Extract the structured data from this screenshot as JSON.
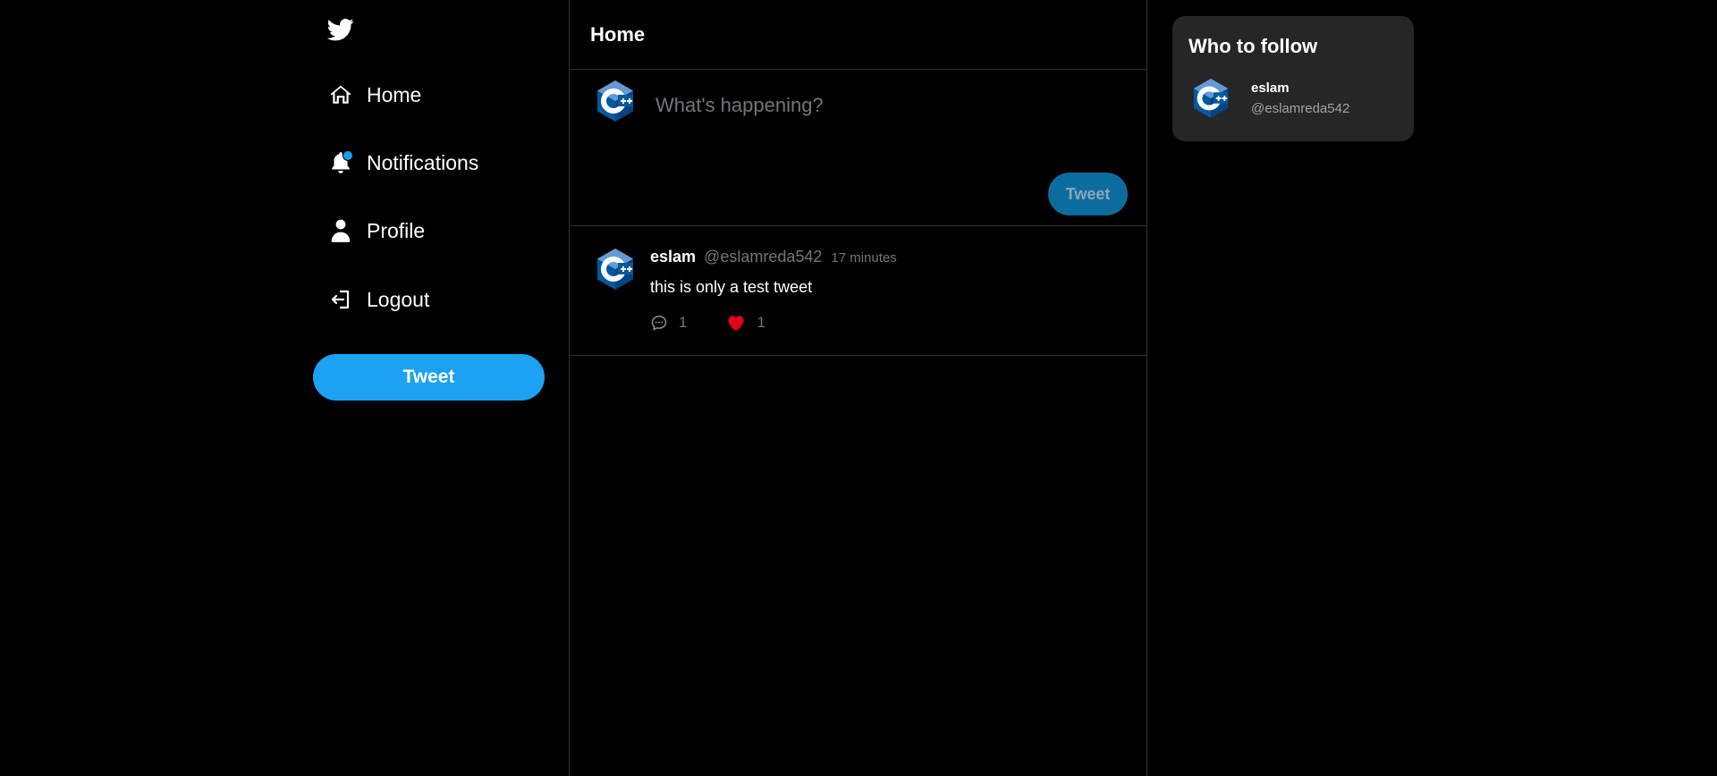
{
  "sidebar": {
    "logo_icon": "twitter-bird-icon",
    "items": [
      {
        "label": "Home",
        "icon": "home-icon"
      },
      {
        "label": "Notifications",
        "icon": "bell-icon",
        "has_unread_dot": true
      },
      {
        "label": "Profile",
        "icon": "user-icon"
      },
      {
        "label": "Logout",
        "icon": "logout-icon"
      }
    ],
    "tweet_button": "Tweet"
  },
  "feed": {
    "title": "Home",
    "composer": {
      "avatar_icon": "cpp-logo-avatar",
      "placeholder": "What's happening?",
      "tweet_button": "Tweet"
    },
    "tweets": [
      {
        "avatar_icon": "cpp-logo-avatar",
        "name": "eslam",
        "handle": "@eslamreda542",
        "time": "17 minutes",
        "text": "this is only a test tweet",
        "comments": "1",
        "likes": "1",
        "liked": true
      }
    ]
  },
  "who_to_follow": {
    "title": "Who to follow",
    "users": [
      {
        "avatar_icon": "cpp-logo-avatar",
        "name": "eslam",
        "handle": "@eslamreda542"
      }
    ]
  },
  "colors": {
    "background": "#000000",
    "accent": "#1da1f2",
    "like": "#e0001b",
    "panel": "#262626",
    "muted_text": "#71767b",
    "divider": "#2f3336"
  }
}
